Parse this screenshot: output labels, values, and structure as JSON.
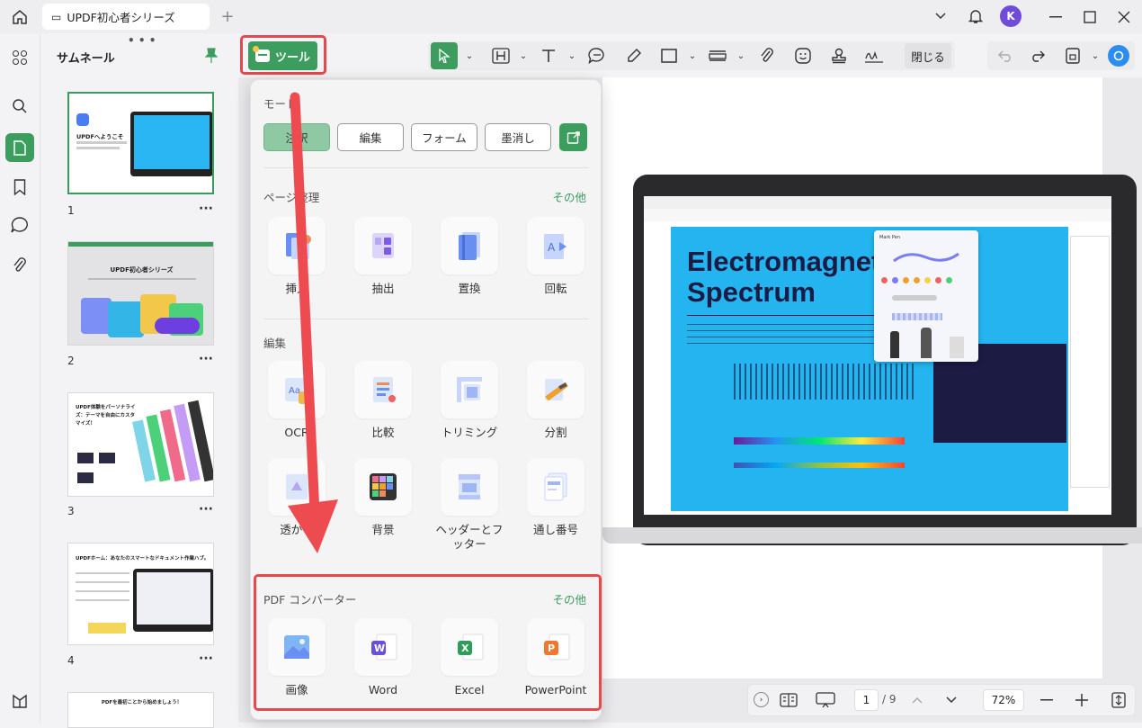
{
  "app": {
    "tab_title": "UPDF初心者シリーズ",
    "avatar_letter": "K"
  },
  "sidebar": {
    "title": "サムネール",
    "pages": [
      {
        "number": "1",
        "heading": "UPDFへようこそ"
      },
      {
        "number": "2",
        "heading": "UPDF初心者シリーズ"
      },
      {
        "number": "3",
        "heading": "UPDF体験をパーソナライズ：テーマを自由にカスタマイズ！"
      },
      {
        "number": "4",
        "heading": "UPDFホーム：あなたのスマートなドキュメント作業ハブ。"
      },
      {
        "number": "",
        "heading": "PDFを最初ことから始めましょう！"
      }
    ]
  },
  "toolbar": {
    "tools_label": "ツール",
    "close_label": "閉じる"
  },
  "popup": {
    "mode_title": "モード",
    "modes": [
      "注釈",
      "編集",
      "フォーム",
      "墨消し"
    ],
    "page_section": {
      "title": "ページ整理",
      "more": "その他",
      "items": [
        "挿入",
        "抽出",
        "置換",
        "回転"
      ]
    },
    "edit_section": {
      "title": "編集",
      "items": [
        "OCR",
        "比較",
        "トリミング",
        "分割",
        "透かし",
        "背景",
        "ヘッダーとフッター",
        "通し番号"
      ]
    },
    "convert_section": {
      "title": "PDF コンバーター",
      "more": "その他",
      "items": [
        "画像",
        "Word",
        "Excel",
        "PowerPoint"
      ]
    }
  },
  "document": {
    "headline_line1": "Electromagnetic",
    "headline_line2": "Spectrum",
    "panel_title": "Mark Pen"
  },
  "statusbar": {
    "page_current": "1",
    "page_total": "/ 9",
    "zoom": "72%"
  },
  "colors": {
    "accent": "#3d9d5f",
    "highlight": "#e5484d",
    "doc_blue": "#24b5f0"
  }
}
